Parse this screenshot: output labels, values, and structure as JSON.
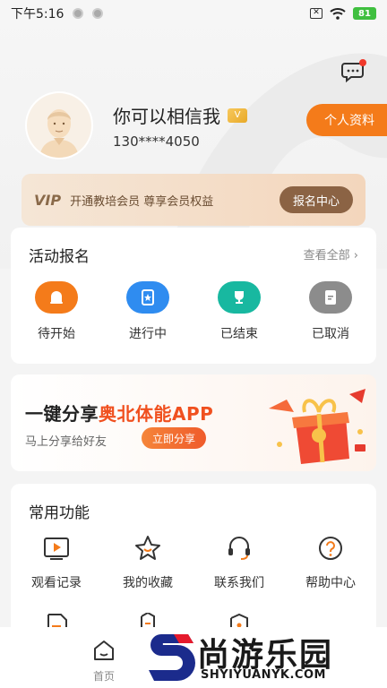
{
  "status_bar": {
    "time": "下午5:16",
    "battery": "81"
  },
  "profile": {
    "name": "你可以相信我",
    "vip_badge": "V",
    "phone": "130****4050",
    "profile_button": "个人资料"
  },
  "vip_banner": {
    "logo": "VIP",
    "text": "开通教培会员 尊享会员权益",
    "button": "报名中心"
  },
  "activity": {
    "title": "活动报名",
    "see_all": "查看全部",
    "items": [
      {
        "label": "待开始",
        "icon": "bell-icon",
        "color": "#f47b1a"
      },
      {
        "label": "进行中",
        "icon": "star-badge-icon",
        "color": "#2f8cf0"
      },
      {
        "label": "已结束",
        "icon": "trophy-icon",
        "color": "#18b8a0"
      },
      {
        "label": "已取消",
        "icon": "doc-cancel-icon",
        "color": "#8c8c8c"
      }
    ]
  },
  "share": {
    "title_prefix": "一键分享",
    "title_highlight": "奥北体能APP",
    "subtitle": "马上分享给好友",
    "button": "立即分享"
  },
  "common": {
    "title": "常用功能",
    "items": [
      {
        "label": "观看记录",
        "icon": "play-icon"
      },
      {
        "label": "我的收藏",
        "icon": "star-icon"
      },
      {
        "label": "联系我们",
        "icon": "headset-icon"
      },
      {
        "label": "帮助中心",
        "icon": "help-icon"
      }
    ]
  },
  "tabbar": {
    "home": "首页"
  },
  "watermark": {
    "cn": "尚游乐园",
    "en": "SHYIYUANYK.COM"
  }
}
